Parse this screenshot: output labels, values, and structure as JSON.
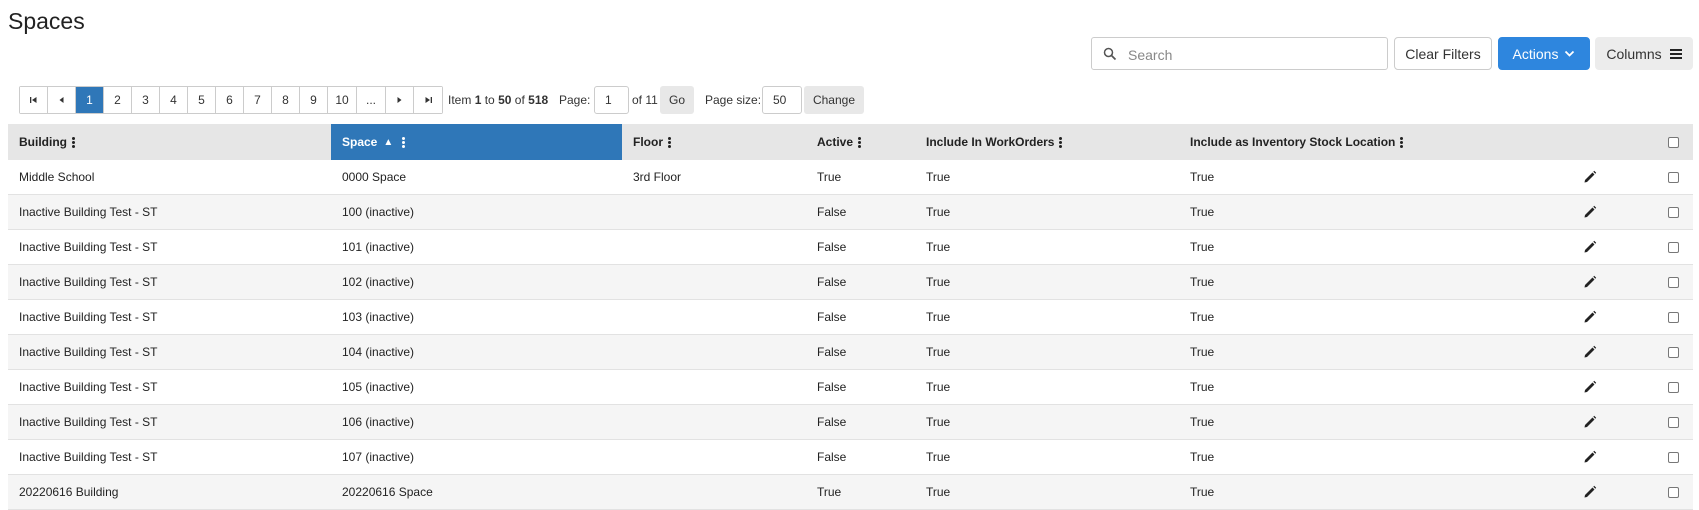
{
  "page": {
    "title": "Spaces"
  },
  "toolbar": {
    "search_placeholder": "Search",
    "search_icon": "search-icon",
    "clear_filters_label": "Clear Filters",
    "actions_label": "Actions",
    "columns_label": "Columns",
    "accent_color": "#2e86de"
  },
  "pager": {
    "first_icon": "first-page-icon",
    "prev_icon": "prev-page-icon",
    "pages": [
      "1",
      "2",
      "3",
      "4",
      "5",
      "6",
      "7",
      "8",
      "9",
      "10",
      "..."
    ],
    "current_page": "1",
    "next_icon": "next-page-icon",
    "last_icon": "last-page-icon",
    "item_prefix": "Item",
    "item_from": "1",
    "item_to_word": "to",
    "item_to": "50",
    "item_of_word": "of",
    "item_total": "518",
    "page_label": "Page:",
    "page_value": "1",
    "of_pages": "of 11",
    "go_label": "Go",
    "page_size_label": "Page size:",
    "page_size_value": "50",
    "change_label": "Change"
  },
  "table": {
    "columns": {
      "building": "Building",
      "space": "Space",
      "floor": "Floor",
      "active": "Active",
      "include_workorders": "Include In WorkOrders",
      "include_inventory": "Include as Inventory Stock Location"
    },
    "sorted_column": "space",
    "sort_direction": "asc",
    "rows": [
      {
        "building": "Middle School",
        "space": "0000 Space",
        "floor": "3rd Floor",
        "active": "True",
        "workorders": "True",
        "inventory": "True"
      },
      {
        "building": "Inactive Building Test - ST",
        "space": "100 (inactive)",
        "floor": "",
        "active": "False",
        "workorders": "True",
        "inventory": "True"
      },
      {
        "building": "Inactive Building Test - ST",
        "space": "101 (inactive)",
        "floor": "",
        "active": "False",
        "workorders": "True",
        "inventory": "True"
      },
      {
        "building": "Inactive Building Test - ST",
        "space": "102 (inactive)",
        "floor": "",
        "active": "False",
        "workorders": "True",
        "inventory": "True"
      },
      {
        "building": "Inactive Building Test - ST",
        "space": "103 (inactive)",
        "floor": "",
        "active": "False",
        "workorders": "True",
        "inventory": "True"
      },
      {
        "building": "Inactive Building Test - ST",
        "space": "104 (inactive)",
        "floor": "",
        "active": "False",
        "workorders": "True",
        "inventory": "True"
      },
      {
        "building": "Inactive Building Test - ST",
        "space": "105 (inactive)",
        "floor": "",
        "active": "False",
        "workorders": "True",
        "inventory": "True"
      },
      {
        "building": "Inactive Building Test - ST",
        "space": "106 (inactive)",
        "floor": "",
        "active": "False",
        "workorders": "True",
        "inventory": "True"
      },
      {
        "building": "Inactive Building Test - ST",
        "space": "107 (inactive)",
        "floor": "",
        "active": "False",
        "workorders": "True",
        "inventory": "True"
      },
      {
        "building": "20220616 Building",
        "space": "20220616 Space",
        "floor": "",
        "active": "True",
        "workorders": "True",
        "inventory": "True"
      }
    ]
  }
}
